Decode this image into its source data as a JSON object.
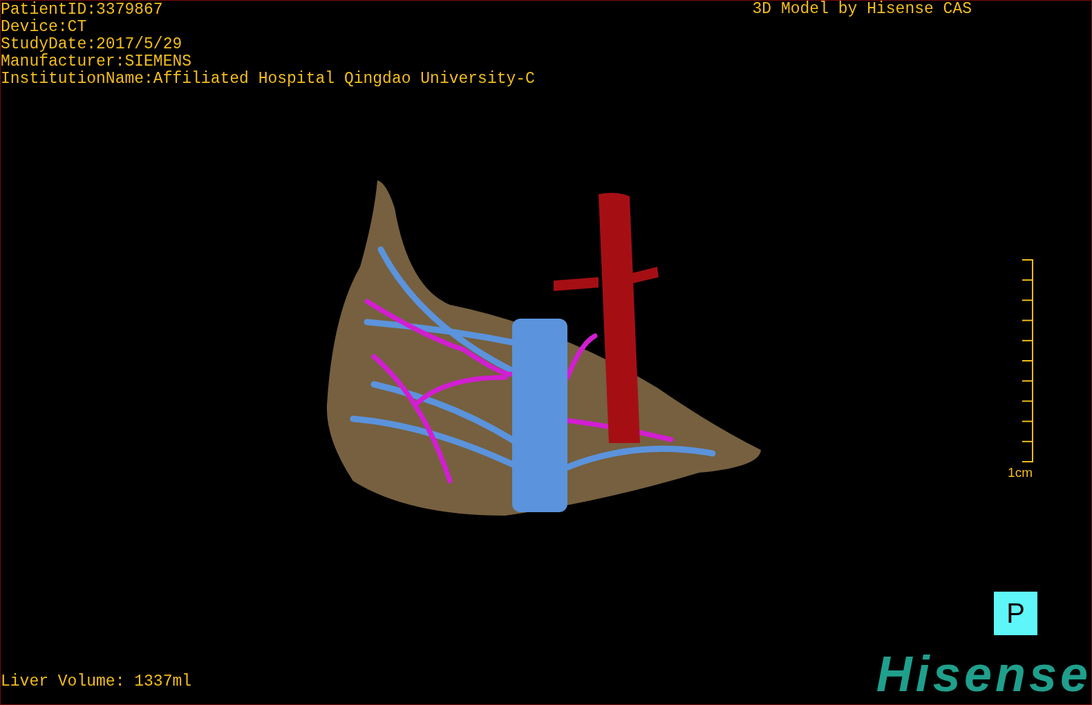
{
  "info_lines": [
    "PatientID:3379867",
    "Device:CT",
    "StudyDate:2017/5/29",
    "Manufacturer:SIEMENS",
    "InstitutionName:Affiliated Hospital Qingdao University-C"
  ],
  "title": "3D Model by Hisense CAS",
  "scale_label": "1cm",
  "volume": "Liver Volume: 1337ml",
  "view_button": "P",
  "logo": "Hisense"
}
